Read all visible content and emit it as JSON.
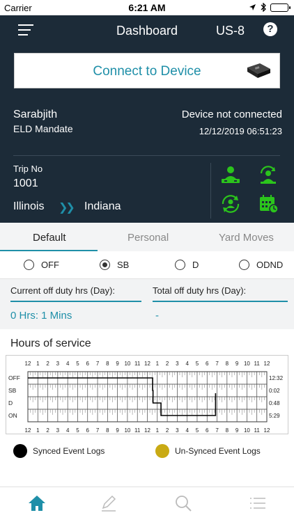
{
  "status_bar": {
    "carrier": "Carrier",
    "time": "6:21 AM"
  },
  "nav": {
    "title": "Dashboard",
    "ruleset": "US-8",
    "help_glyph": "?"
  },
  "connect": {
    "label": "Connect to Device",
    "icon": "eld-device-icon"
  },
  "driver": {
    "name": "Sarabjith",
    "subtitle": "ELD Mandate"
  },
  "device": {
    "status": "Device not connected",
    "datetime": "12/12/2019 06:51:23"
  },
  "trip": {
    "label": "Trip No",
    "number": "1001",
    "from": "Illinois",
    "to": "Indiana"
  },
  "tabs": [
    "Default",
    "Personal",
    "Yard Moves"
  ],
  "duty_status": [
    {
      "label": "OFF",
      "selected": false
    },
    {
      "label": "SB",
      "selected": true
    },
    {
      "label": "D",
      "selected": false
    },
    {
      "label": "ODND",
      "selected": false
    }
  ],
  "summary": {
    "current_label": "Current off duty hrs (Day):",
    "current_value": "0 Hrs: 1 Mins",
    "total_label": "Total off duty hrs (Day):",
    "total_value": "-"
  },
  "hos": {
    "title": "Hours of service",
    "hour_labels": [
      "12",
      "1",
      "2",
      "3",
      "4",
      "5",
      "6",
      "7",
      "8",
      "9",
      "10",
      "11",
      "12",
      "1",
      "2",
      "3",
      "4",
      "5",
      "6",
      "7",
      "8",
      "9",
      "10",
      "11",
      "12"
    ],
    "rows": [
      "OFF",
      "SB",
      "D",
      "ON"
    ],
    "totals": [
      "12:32",
      "0:02",
      "0:48",
      "5:29"
    ],
    "timeline": [
      {
        "status": "OFF",
        "start_hr": 0,
        "end_hr": 12.53
      },
      {
        "status": "SB",
        "start_hr": 12.53,
        "end_hr": 12.57
      },
      {
        "status": "D",
        "start_hr": 12.57,
        "end_hr": 13.37
      },
      {
        "status": "ON",
        "start_hr": 13.37,
        "end_hr": 18.85
      },
      {
        "status": "D",
        "start_hr": 18.85,
        "end_hr": 18.85
      }
    ]
  },
  "legend": {
    "synced": "Synced Event Logs",
    "unsynced": "Un-Synced Event Logs",
    "synced_color": "#000000",
    "unsynced_color": "#c9aa14"
  },
  "colors": {
    "accent": "#1f8fa8",
    "header_bg": "#1c2b38",
    "icon_green": "#2bc41c"
  }
}
